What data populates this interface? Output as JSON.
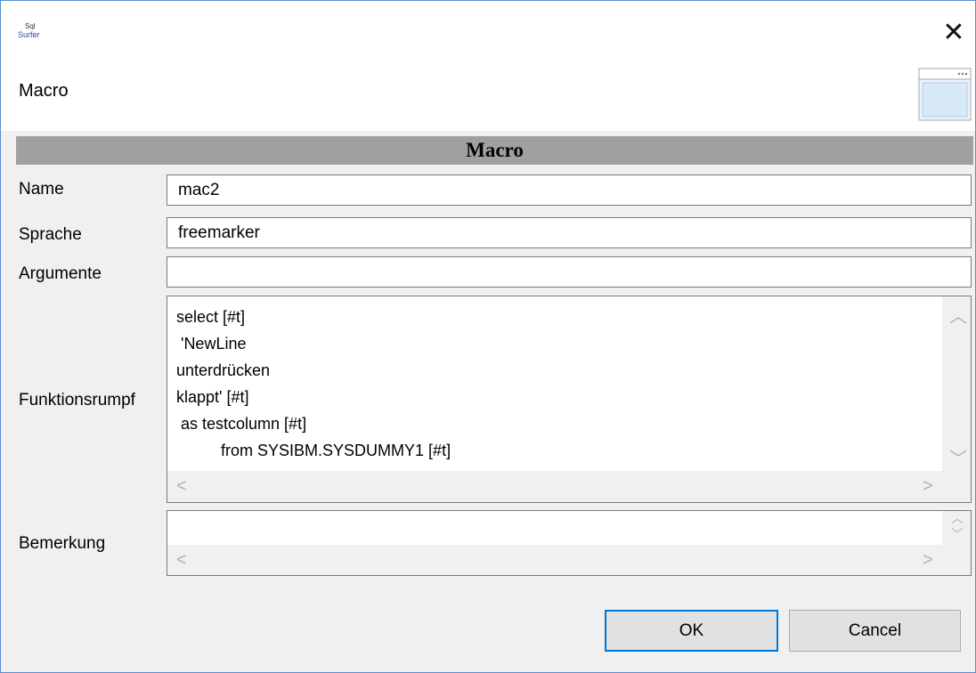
{
  "window": {
    "app_icon": "sqlsurfer-logo-icon",
    "close_glyph": "✕",
    "header_title": "Macro",
    "header_graphic": "window-graphic-icon"
  },
  "form": {
    "section_title": "Macro",
    "name_label": "Name",
    "name_value": "mac2",
    "sprache_label": "Sprache",
    "sprache_value": "freemarker",
    "argumente_label": "Argumente",
    "argumente_value": "",
    "funktionsrumpf_label": "Funktionsrumpf",
    "funktionsrumpf_value": "select [#t]\n 'NewLine\nunterdrücken\nklappt' [#t]\n as testcolumn [#t]\n          from SYSIBM.SYSDUMMY1 [#t]",
    "bemerkung_label": "Bemerkung",
    "bemerkung_value": ""
  },
  "buttons": {
    "ok_label": "OK",
    "cancel_label": "Cancel"
  }
}
